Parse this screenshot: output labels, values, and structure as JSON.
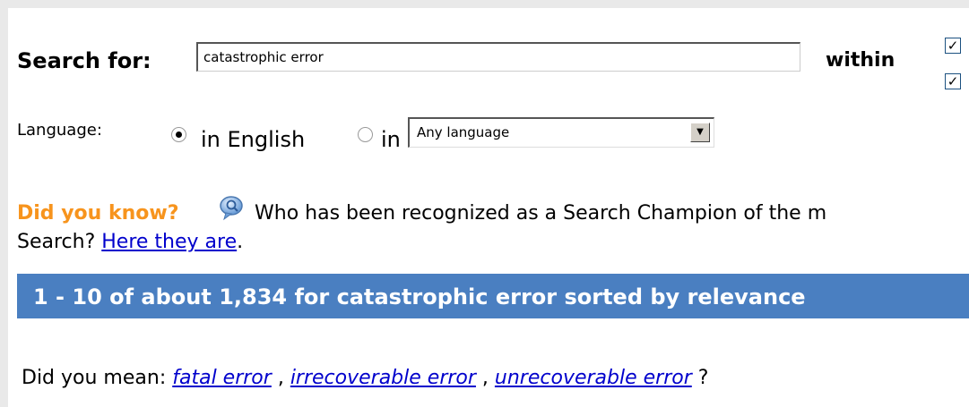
{
  "search": {
    "label": "Search for:",
    "query": "catastrophic error",
    "within_label": "within"
  },
  "language": {
    "label": "Language:",
    "option_english": "in English",
    "option_in": "in",
    "select_value": "Any language"
  },
  "did_you_know": {
    "title": "Did you know?",
    "text": "Who has been recognized as a Search Champion of the m",
    "line2_prefix": "Search?",
    "link": "Here they are",
    "line2_suffix": "."
  },
  "results": {
    "summary": "1 - 10 of about 1,834 for catastrophic error sorted by relevance"
  },
  "suggestions": {
    "prefix": "Did you mean:",
    "items": [
      "fatal error",
      "irrecoverable error",
      "unrecoverable error"
    ],
    "sep1": ",",
    "sep2": ",",
    "suffix": "?"
  },
  "icons": {
    "dyk_icon": "speech-bubble-magnifier-icon",
    "check_mark": "✓"
  }
}
